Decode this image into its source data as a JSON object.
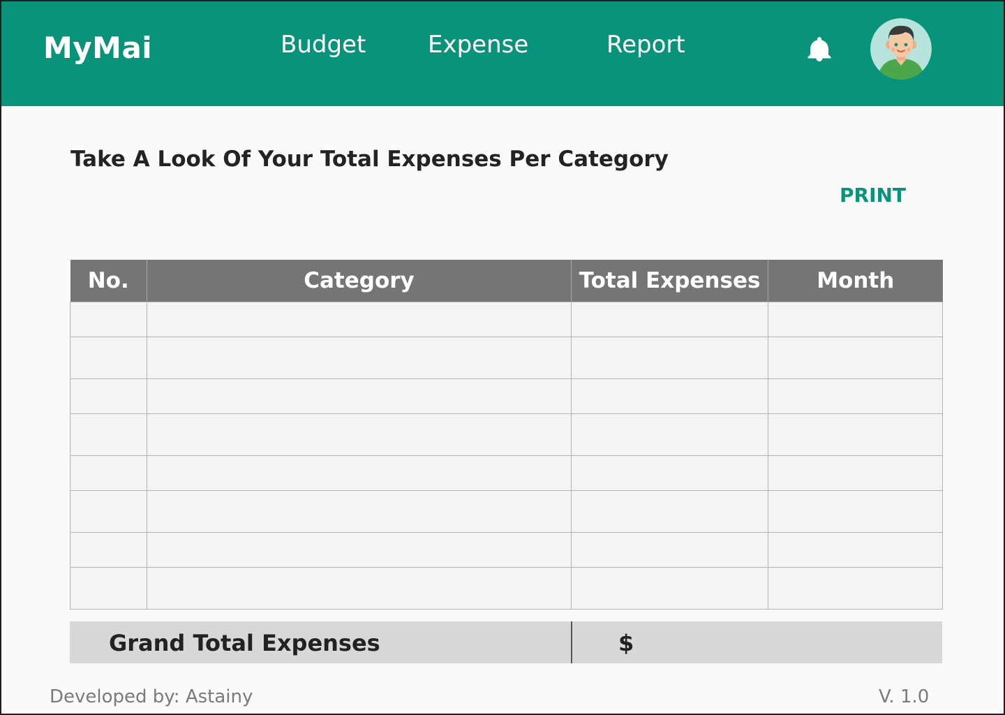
{
  "header": {
    "logo": "MyMai",
    "nav": {
      "budget": "Budget",
      "expense": "Expense",
      "report": "Report"
    },
    "icons": {
      "notifications": "bell-icon",
      "profile": "user-avatar"
    },
    "colors": {
      "brand": "#08937a",
      "text": "#ffffff"
    }
  },
  "main": {
    "title": "Take A Look Of Your Total Expenses Per Category",
    "print_label": "PRINT",
    "table": {
      "columns": [
        "No.",
        "Category",
        "Total Expenses",
        "Month"
      ],
      "rows": [
        [
          "",
          "",
          "",
          ""
        ],
        [
          "",
          "",
          "",
          ""
        ],
        [
          "",
          "",
          "",
          ""
        ],
        [
          "",
          "",
          "",
          ""
        ],
        [
          "",
          "",
          "",
          ""
        ],
        [
          "",
          "",
          "",
          ""
        ],
        [
          "",
          "",
          "",
          ""
        ],
        [
          "",
          "",
          "",
          ""
        ]
      ]
    },
    "grand_total": {
      "label": "Grand Total Expenses",
      "currency": "$"
    }
  },
  "footer": {
    "developer": "Developed by: Astainy",
    "version": "V. 1.0"
  }
}
